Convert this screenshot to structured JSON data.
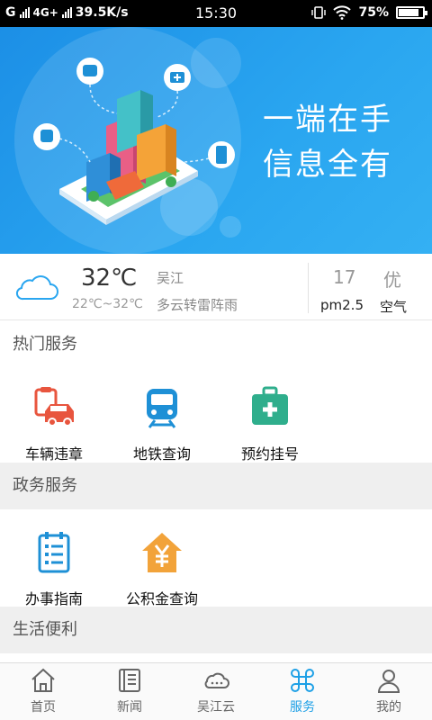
{
  "status_bar": {
    "carrier": "G",
    "network": "4G+",
    "speed": "39.5K/s",
    "time": "15:30",
    "battery": "75%"
  },
  "banner": {
    "slogan_line1": "一端在手",
    "slogan_line2": "信息全有"
  },
  "weather": {
    "temperature": "32℃",
    "range": "22℃~32℃",
    "city": "吴江",
    "description": "多云转雷阵雨",
    "pm25_value": "17",
    "pm25_label": "pm2.5",
    "air_value": "优",
    "air_label": "空气"
  },
  "sections": {
    "hot": {
      "title": "热门服务",
      "items": [
        {
          "label": "车辆违章",
          "icon": "car-violation-icon",
          "color": "#e8553e"
        },
        {
          "label": "地铁查询",
          "icon": "subway-icon",
          "color": "#1e90d6"
        },
        {
          "label": "预约挂号",
          "icon": "medical-kit-icon",
          "color": "#2fae8c"
        }
      ]
    },
    "gov": {
      "title": "政务服务",
      "items": [
        {
          "label": "办事指南",
          "icon": "checklist-icon",
          "color": "#1e90d6"
        },
        {
          "label": "公积金查询",
          "icon": "housing-fund-icon",
          "color": "#f2a33a"
        }
      ]
    },
    "life": {
      "title": "生活便利"
    }
  },
  "bottom_nav": [
    {
      "label": "首页",
      "icon": "home-icon",
      "active": false
    },
    {
      "label": "新闻",
      "icon": "news-icon",
      "active": false
    },
    {
      "label": "吴江云",
      "icon": "cloud-icon",
      "active": false
    },
    {
      "label": "服务",
      "icon": "services-icon",
      "active": true
    },
    {
      "label": "我的",
      "icon": "profile-icon",
      "active": false
    }
  ],
  "colors": {
    "brand_blue": "#1ea0e6",
    "banner_blue": "#2aa6f0"
  }
}
